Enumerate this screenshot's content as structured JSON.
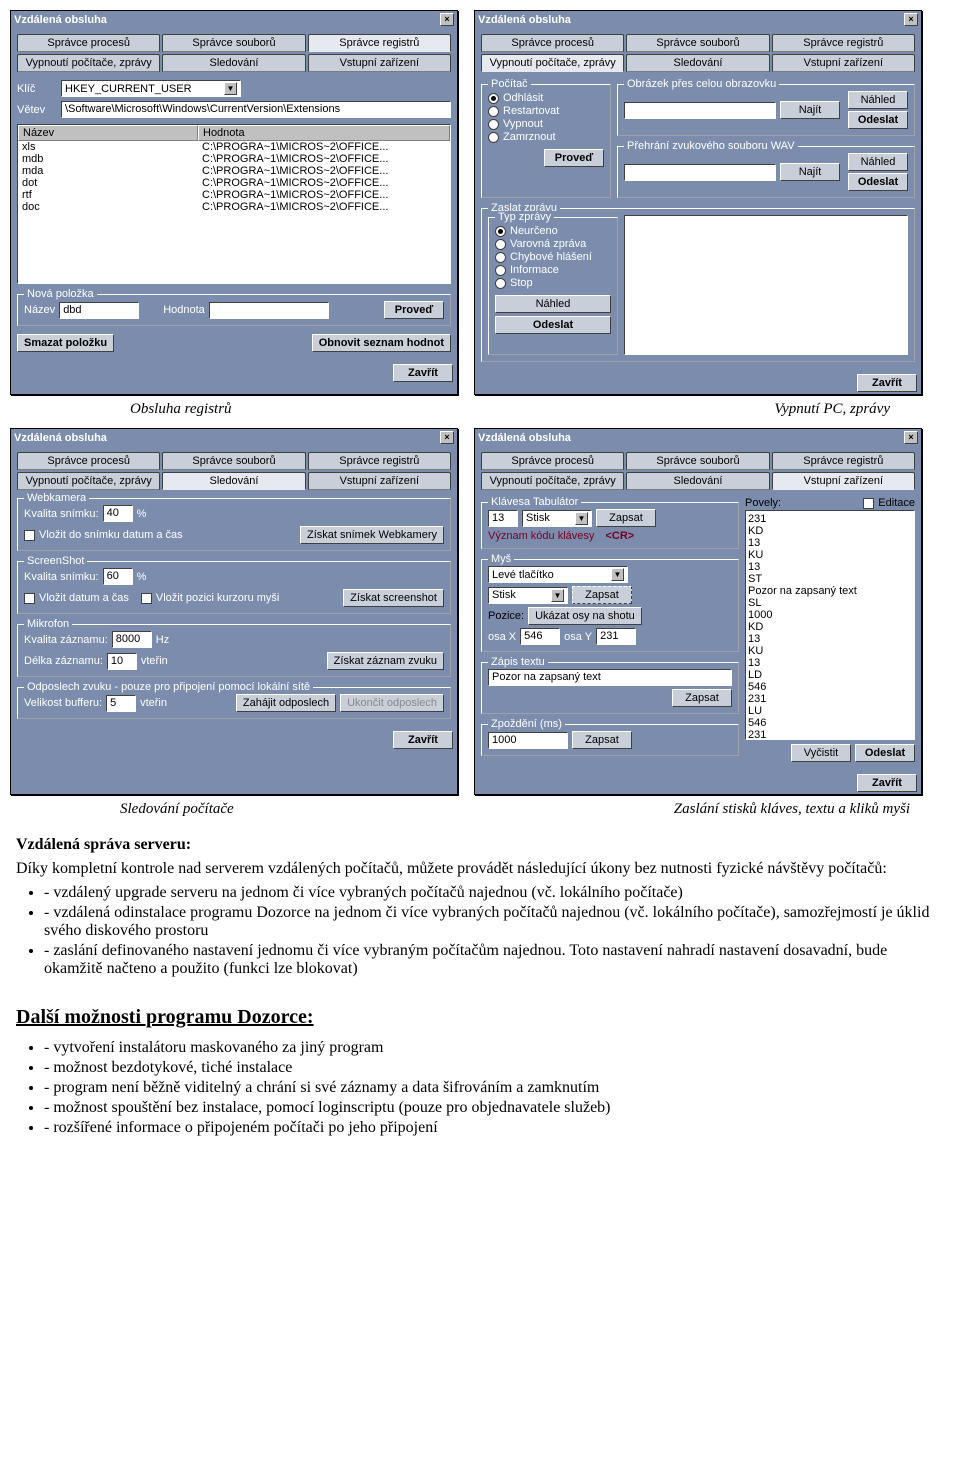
{
  "dialog_title": "Vzdálená obsluha",
  "close_glyph": "×",
  "tabs_row1": [
    "Správce procesů",
    "Správce souborů",
    "Správce registrů"
  ],
  "tabs_row2": [
    "Vypnoutí počítače, zprávy",
    "Sledování",
    "Vstupní zařízení"
  ],
  "btn_zavrit": "Zavřít",
  "win1": {
    "klic": "Klíč",
    "klic_val": "HKEY_CURRENT_USER",
    "vetev": "Větev",
    "vetev_val": "\\Software\\Microsoft\\Windows\\CurrentVersion\\Extensions",
    "col_nazev": "Název",
    "col_hodnota": "Hodnota",
    "rows": [
      {
        "n": "xls",
        "h": "C:\\PROGRA~1\\MICROS~2\\OFFICE..."
      },
      {
        "n": "mdb",
        "h": "C:\\PROGRA~1\\MICROS~2\\OFFICE..."
      },
      {
        "n": "mda",
        "h": "C:\\PROGRA~1\\MICROS~2\\OFFICE..."
      },
      {
        "n": "dot",
        "h": "C:\\PROGRA~1\\MICROS~2\\OFFICE..."
      },
      {
        "n": "rtf",
        "h": "C:\\PROGRA~1\\MICROS~2\\OFFICE..."
      },
      {
        "n": "doc",
        "h": "C:\\PROGRA~1\\MICROS~2\\OFFICE..."
      }
    ],
    "nova_polozka": "Nová položka",
    "nazev": "Název",
    "nazev_val": "dbd",
    "hodnota": "Hodnota",
    "proved": "Proveď",
    "smazat": "Smazat položku",
    "obnovit": "Obnovit seznam hodnot"
  },
  "win2": {
    "pocitac": "Počítač",
    "odhlasit": "Odhlásit",
    "restartovat": "Restartovat",
    "vypnout": "Vypnout",
    "zamrznout": "Zamrznout",
    "proved": "Proveď",
    "obrazek": "Obrázek přes celou obrazovku",
    "najit": "Najít",
    "nahled": "Náhled",
    "odeslat": "Odeslat",
    "prehrani": "Přehrání zvukového souboru WAV",
    "zaslat": "Zaslat zprávu",
    "typ": "Typ zprávy",
    "neurceno": "Neurčeno",
    "varovna": "Varovná zpráva",
    "chybove": "Chybové hlášení",
    "informace": "Informace",
    "stop": "Stop"
  },
  "win3": {
    "webkamera": "Webkamera",
    "kvalita_s": "Kvalita snímku:",
    "kv40": "40",
    "kv60": "60",
    "pct": "%",
    "vlozit_datum": "Vložit do snímku datum a čas",
    "ziskat_web": "Získat snímek Webkamery",
    "screenshot": "ScreenShot",
    "vlozit_datum2": "Vložit datum a čas",
    "vlozit_pozici": "Vložit pozici kurzoru myši",
    "ziskat_screen": "Získat screenshot",
    "mikrofon": "Mikrofon",
    "kvalita_z": "Kvalita záznamu:",
    "hz": "8000",
    "hz_u": "Hz",
    "delka": "Délka záznamu:",
    "sec": "10",
    "vterin": "vteřin",
    "ziskat_zvuk": "Získat záznam zvuku",
    "odposlech": "Odposlech zvuku - pouze pro připojení pomocí lokální sítě",
    "velikost": "Velikost bufferu:",
    "buf": "5",
    "zahajit": "Zahájit odposlech",
    "ukoncit": "Ukončit odposlech"
  },
  "win4": {
    "klavesa": "Klávesa",
    "tabulator": "Tabulátor",
    "kcode": "13",
    "stisk": "Stisk",
    "zapsat": "Zapsat",
    "vyznam": "Význam kódu klávesy",
    "cr": "<CR>",
    "mys": "Myš",
    "leve": "Levé tlačítko",
    "pozice": "Pozice:",
    "ukazat": "Ukázat osy na shotu",
    "osax": "osa X",
    "xval": "546",
    "osay": "osa Y",
    "yval": "231",
    "zapis_textu": "Zápis textu",
    "pozor": "Pozor na zapsaný text",
    "zpozdeni": "Zpoždění (ms)",
    "zp_val": "1000",
    "povely": "Povely:",
    "editace": "Editace",
    "povely_list": [
      "231",
      "KD",
      "13",
      "KU",
      "13",
      "ST",
      "Pozor na zapsaný text",
      "SL",
      "1000",
      "KD",
      "13",
      "KU",
      "13",
      "LD",
      "546",
      "231",
      "LU",
      "546",
      "231"
    ],
    "vycistit": "Vyčistit",
    "odeslat": "Odeslat"
  },
  "captions": {
    "c1": "Obsluha registrů",
    "c2": "Vypnutí PC, zprávy",
    "c3": "Sledování počítače",
    "c4": "Zaslání stisků kláves, textu a kliků myši"
  },
  "doc": {
    "h1": "Vzdálená správa serveru:",
    "p1": "Díky kompletní kontrole nad serverem vzdálených počítačů, můžete provádět následující úkony bez nutnosti fyzické návštěvy počítačů:",
    "li1": "vzdálený upgrade serveru na jednom či více vybraných počítačů najednou (vč. lokálního počítače)",
    "li2": "vzdálená odinstalace programu Dozorce na jednom či více vybraných počítačů najednou (vč. lokálního počítače), samozřejmostí je úklid svého diskového prostoru",
    "li3": "zaslání definovaného nastavení jednomu či více vybraným počítačům najednou. Toto nastavení nahradí nastavení dosavadní, bude okamžitě načteno a použito (funkci lze blokovat)",
    "h2": "Další možnosti programu Dozorce:",
    "li4": "vytvoření instalátoru maskovaného za jiný program",
    "li5": "možnost bezdotykové, tiché instalace",
    "li6": "program není běžně viditelný a chrání si své záznamy a data šifrováním a zamknutím",
    "li7": "možnost spouštění bez instalace, pomocí loginscriptu (pouze pro objednavatele služeb)",
    "li8": "rozšířené informace o připojeném počítači po jeho připojení"
  }
}
